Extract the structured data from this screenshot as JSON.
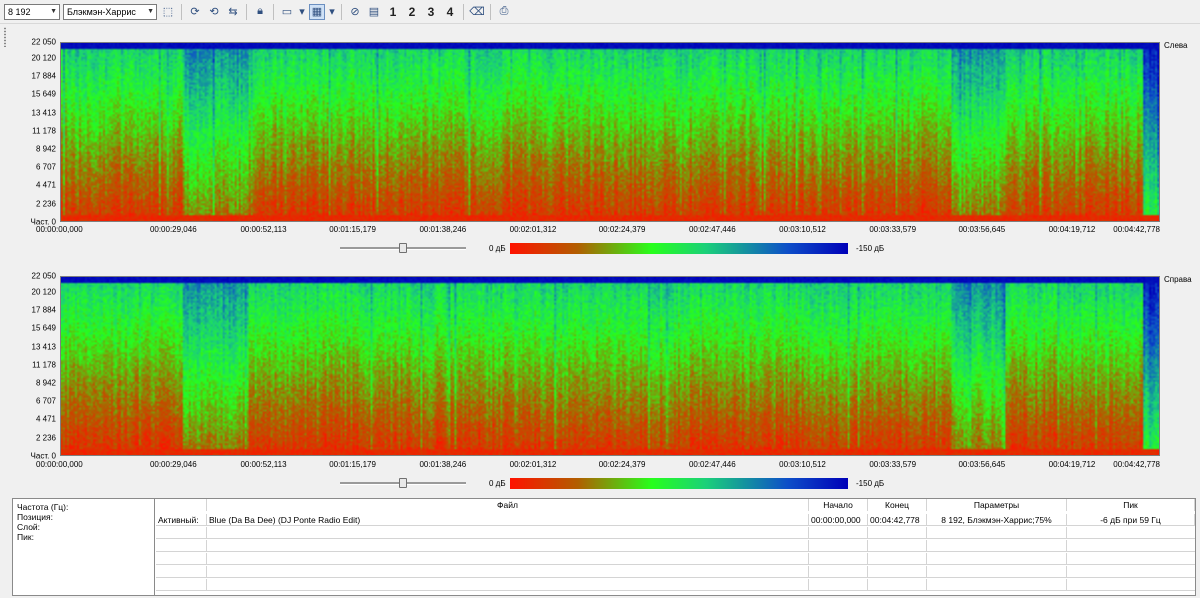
{
  "toolbar": {
    "fft_size": "8 192",
    "window_function": "Блэкмэн-Харрис",
    "channel_buttons": [
      "1",
      "2",
      "3",
      "4"
    ]
  },
  "frequency_ticks": [
    "22 050",
    "20 120",
    "17 884",
    "15 649",
    "13 413",
    "11 178",
    "8 942",
    "6 707",
    "4 471",
    "2 236",
    "Част. 0"
  ],
  "time_ticks": [
    "00:00:00,000",
    "00:00:29,046",
    "00:00:52,113",
    "00:01:15,179",
    "00:01:38,246",
    "00:02:01,312",
    "00:02:24,379",
    "00:02:47,446",
    "00:03:10,512",
    "00:03:33,579",
    "00:03:56,645",
    "00:04:19,712",
    "00:04:42,778"
  ],
  "panels": [
    {
      "channel": "Слева",
      "slider_value": 0.5
    },
    {
      "channel": "Справа",
      "slider_value": 0.5
    }
  ],
  "legend": {
    "min_label": "0 дБ",
    "max_label": "-150 дБ"
  },
  "colors": {
    "hot": "#ff1200",
    "mid": "#27ff1c",
    "cold": "#0000b8",
    "top_band": "#0a2a9a"
  },
  "info": {
    "labels": [
      "Частота (Гц):",
      "Позиция:",
      "Слой:",
      "Пик:"
    ],
    "columns": {
      "file": "Файл",
      "start": "Начало",
      "end": "Конец",
      "params": "Параметры",
      "peak": "Пик"
    },
    "row": {
      "status": "Активный:",
      "file": "Blue (Da Ba Dee) (DJ Ponte Radio Edit)",
      "start": "00:00:00,000",
      "end": "00:04:42,778",
      "params": "8 192, Блэкмэн-Харрис;75%",
      "peak": "-6 дБ при 59 Гц"
    }
  }
}
